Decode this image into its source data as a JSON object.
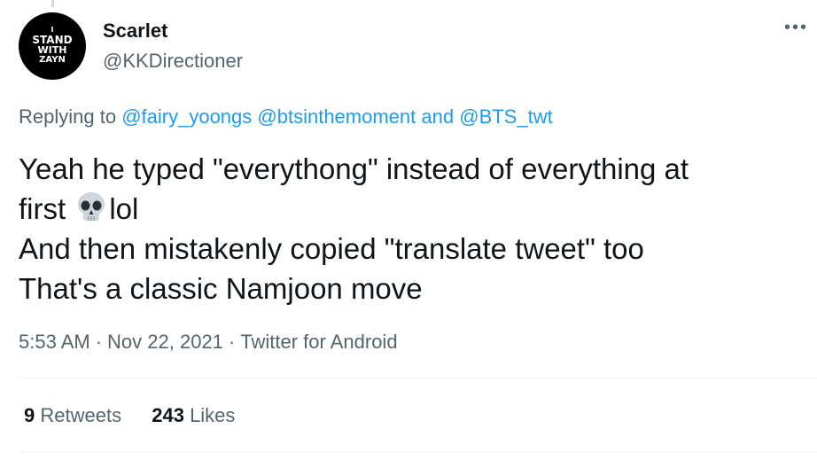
{
  "author": {
    "avatar_text": [
      "I",
      "STAND",
      "WITH",
      "ZAYN"
    ],
    "display_name": "Scarlet",
    "username": "@KKDirectioner"
  },
  "more_icon": "more-dots-icon",
  "replying": {
    "prefix": "Replying to",
    "mention1": "@fairy_yoongs",
    "mention2": "@btsinthemoment",
    "connector": "and",
    "mention3": "@BTS_twt"
  },
  "tweet": {
    "line1": "Yeah he typed \"everythong\" instead of everything at",
    "line2_before": "first",
    "emoji": "skull-icon",
    "line2_after": "lol",
    "line3": "And then mistakenly copied \"translate tweet\" too",
    "line4": "That's a classic Namjoon move"
  },
  "meta": {
    "time": "5:53 AM",
    "date": "Nov 22, 2021",
    "source": "Twitter for Android"
  },
  "stats": {
    "retweets_count": "9",
    "retweets_label": "Retweets",
    "likes_count": "243",
    "likes_label": "Likes"
  },
  "colors": {
    "link": "#1d9bf0",
    "secondary": "#536471",
    "primary": "#0f1419"
  }
}
